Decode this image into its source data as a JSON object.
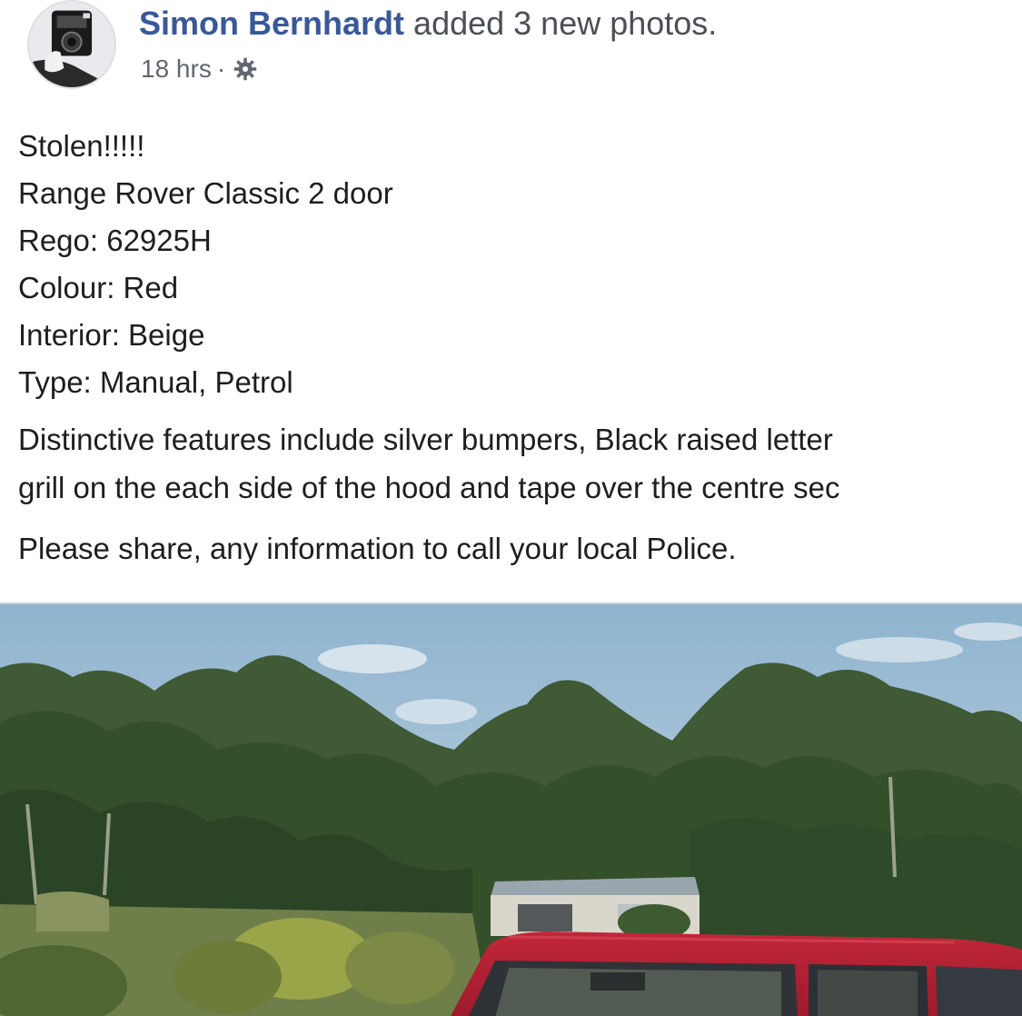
{
  "post": {
    "author": "Simon Bernhardt",
    "action": "added 3 new photos.",
    "time": "18 hrs",
    "separator": "·",
    "privacy_icon": "gear-icon",
    "lines": [
      "Stolen!!!!!",
      "Range Rover Classic 2 door",
      "Rego: 62925H",
      "Colour: Red",
      "Interior: Beige",
      "Type: Manual, Petrol"
    ],
    "features": [
      "Distinctive features include silver bumpers, Black raised letter",
      "grill on the each side of the hood and tape over the centre sec"
    ],
    "closing": "Please share, any information to call your local Police."
  },
  "colors": {
    "author_link": "#385898",
    "meta_text": "#616770",
    "body_text": "#1c1e21",
    "car_red": "#b01e2e"
  }
}
